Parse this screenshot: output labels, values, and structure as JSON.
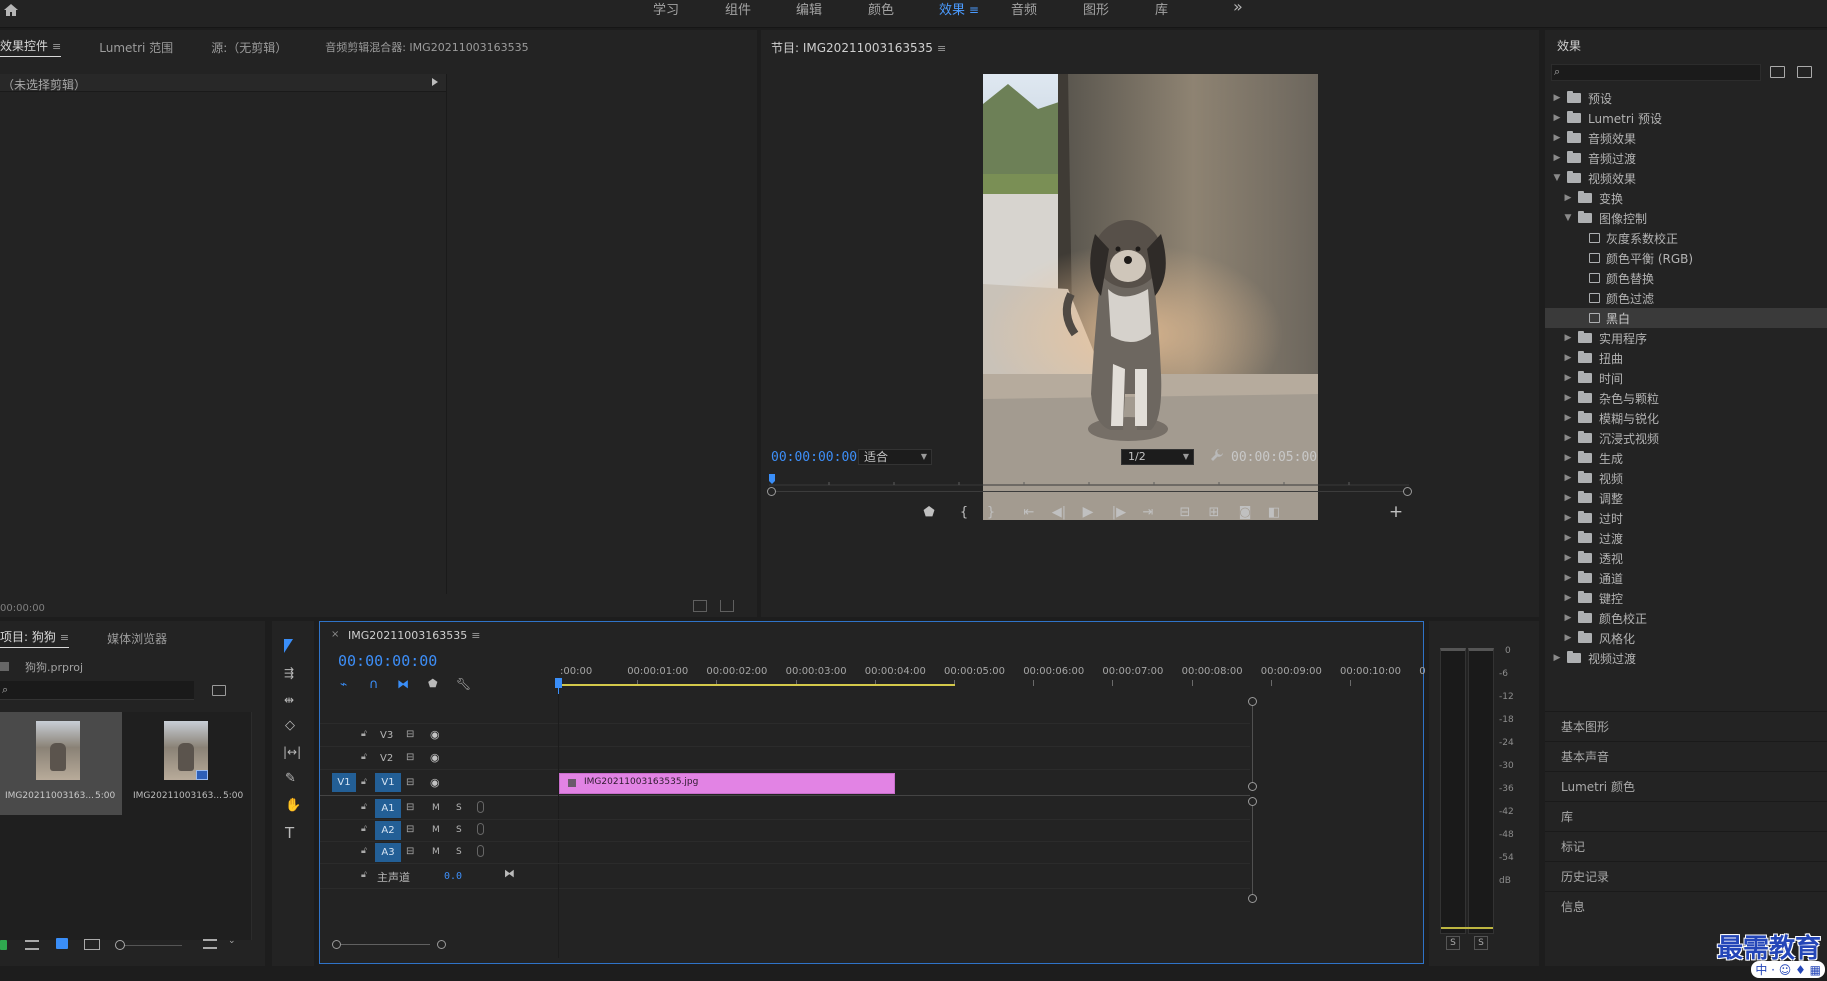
{
  "workspace_tabs": [
    {
      "label": "学习"
    },
    {
      "label": "组件"
    },
    {
      "label": "编辑"
    },
    {
      "label": "颜色"
    },
    {
      "label": "效果",
      "active": true
    },
    {
      "label": "音频"
    },
    {
      "label": "图形"
    },
    {
      "label": "库"
    }
  ],
  "more_glyph": "»",
  "effect_controls": {
    "tabs": [
      "效果控件",
      "Lumetri 范围",
      "源:（无剪辑）",
      "音频剪辑混合器: IMG20211003163535"
    ],
    "no_clip": "（未选择剪辑）",
    "timecode": "00:00:00"
  },
  "program": {
    "title": "节目: IMG20211003163535",
    "timecode": "00:00:00:00",
    "fit": "适合",
    "resolution": "1/2",
    "duration": "00:00:05:00"
  },
  "project": {
    "tabs": [
      "项目: 狗狗",
      "媒体浏览器"
    ],
    "file": "狗狗.prproj",
    "items": [
      {
        "name": "IMG20211003163...",
        "dur": "5:00"
      },
      {
        "name": "IMG20211003163...",
        "dur": "5:00"
      }
    ]
  },
  "timeline": {
    "tab": "IMG20211003163535",
    "timecode": "00:00:00:00",
    "ruler": [
      ":00:00",
      "00:00:01:00",
      "00:00:02:00",
      "00:00:03:00",
      "00:00:04:00",
      "00:00:05:00",
      "00:00:06:00",
      "00:00:07:00",
      "00:00:08:00",
      "00:00:09:00",
      "00:00:10:00",
      "0"
    ],
    "video_tracks": [
      "V3",
      "V2",
      "V1"
    ],
    "source_patch": "V1",
    "audio_tracks": [
      "A1",
      "A2",
      "A3"
    ],
    "mute": "M",
    "solo": "S",
    "master": "主声道",
    "master_value": "0.0",
    "clip": "IMG20211003163535.jpg",
    "clip_color": "#e283e4"
  },
  "meter": {
    "scale": [
      "0",
      "-6",
      "-12",
      "-18",
      "-24",
      "-30",
      "-36",
      "-42",
      "-48",
      "-54",
      "dB"
    ],
    "solo": [
      "S",
      "S"
    ]
  },
  "effects": {
    "title": "效果",
    "tree": [
      {
        "label": "预设",
        "level": 0,
        "type": "folder",
        "arrow": "›"
      },
      {
        "label": "Lumetri 预设",
        "level": 0,
        "type": "folder",
        "arrow": "›"
      },
      {
        "label": "音频效果",
        "level": 0,
        "type": "folder",
        "arrow": "›"
      },
      {
        "label": "音频过渡",
        "level": 0,
        "type": "folder",
        "arrow": "›"
      },
      {
        "label": "视频效果",
        "level": 0,
        "type": "folder",
        "arrow": "⌄"
      },
      {
        "label": "变换",
        "level": 1,
        "type": "folder",
        "arrow": "›"
      },
      {
        "label": "图像控制",
        "level": 1,
        "type": "folder",
        "arrow": "⌄"
      },
      {
        "label": "灰度系数校正",
        "level": 2,
        "type": "fx"
      },
      {
        "label": "颜色平衡 (RGB)",
        "level": 2,
        "type": "fx"
      },
      {
        "label": "颜色替换",
        "level": 2,
        "type": "fx"
      },
      {
        "label": "颜色过滤",
        "level": 2,
        "type": "fx"
      },
      {
        "label": "黑白",
        "level": 2,
        "type": "fx",
        "selected": true
      },
      {
        "label": "实用程序",
        "level": 1,
        "type": "folder",
        "arrow": "›"
      },
      {
        "label": "扭曲",
        "level": 1,
        "type": "folder",
        "arrow": "›"
      },
      {
        "label": "时间",
        "level": 1,
        "type": "folder",
        "arrow": "›"
      },
      {
        "label": "杂色与颗粒",
        "level": 1,
        "type": "folder",
        "arrow": "›"
      },
      {
        "label": "模糊与锐化",
        "level": 1,
        "type": "folder",
        "arrow": "›"
      },
      {
        "label": "沉浸式视频",
        "level": 1,
        "type": "folder",
        "arrow": "›"
      },
      {
        "label": "生成",
        "level": 1,
        "type": "folder",
        "arrow": "›"
      },
      {
        "label": "视频",
        "level": 1,
        "type": "folder",
        "arrow": "›"
      },
      {
        "label": "调整",
        "level": 1,
        "type": "folder",
        "arrow": "›"
      },
      {
        "label": "过时",
        "level": 1,
        "type": "folder",
        "arrow": "›"
      },
      {
        "label": "过渡",
        "level": 1,
        "type": "folder",
        "arrow": "›"
      },
      {
        "label": "透视",
        "level": 1,
        "type": "folder",
        "arrow": "›"
      },
      {
        "label": "通道",
        "level": 1,
        "type": "folder",
        "arrow": "›"
      },
      {
        "label": "键控",
        "level": 1,
        "type": "folder",
        "arrow": "›"
      },
      {
        "label": "颜色校正",
        "level": 1,
        "type": "folder",
        "arrow": "›"
      },
      {
        "label": "风格化",
        "level": 1,
        "type": "folder",
        "arrow": "›"
      },
      {
        "label": "视频过渡",
        "level": 0,
        "type": "folder",
        "arrow": "›"
      }
    ],
    "side_panels": [
      "基本图形",
      "基本声音",
      "Lumetri 颜色",
      "库",
      "标记",
      "历史记录",
      "信息"
    ]
  },
  "watermark": {
    "title": "最需教育",
    "sub": "中 · ☺ ♦ ▦"
  }
}
